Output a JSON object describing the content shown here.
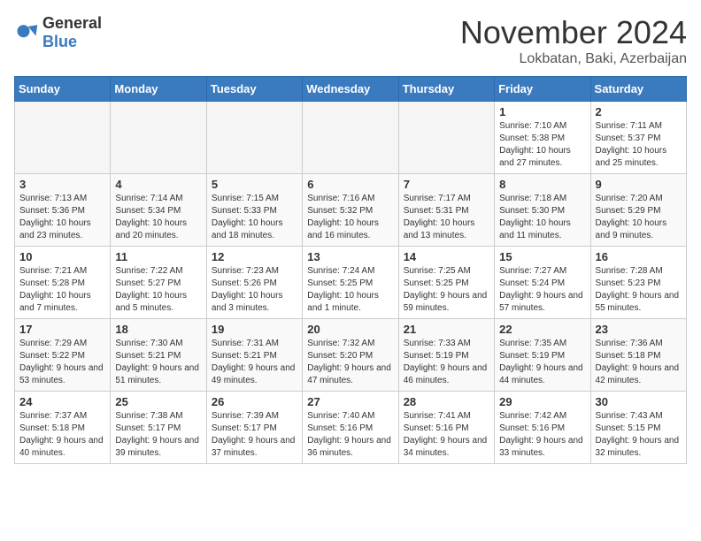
{
  "header": {
    "logo_general": "General",
    "logo_blue": "Blue",
    "month_title": "November 2024",
    "location": "Lokbatan, Baki, Azerbaijan"
  },
  "weekdays": [
    "Sunday",
    "Monday",
    "Tuesday",
    "Wednesday",
    "Thursday",
    "Friday",
    "Saturday"
  ],
  "weeks": [
    [
      {
        "day": "",
        "info": ""
      },
      {
        "day": "",
        "info": ""
      },
      {
        "day": "",
        "info": ""
      },
      {
        "day": "",
        "info": ""
      },
      {
        "day": "",
        "info": ""
      },
      {
        "day": "1",
        "info": "Sunrise: 7:10 AM\nSunset: 5:38 PM\nDaylight: 10 hours and 27 minutes."
      },
      {
        "day": "2",
        "info": "Sunrise: 7:11 AM\nSunset: 5:37 PM\nDaylight: 10 hours and 25 minutes."
      }
    ],
    [
      {
        "day": "3",
        "info": "Sunrise: 7:13 AM\nSunset: 5:36 PM\nDaylight: 10 hours and 23 minutes."
      },
      {
        "day": "4",
        "info": "Sunrise: 7:14 AM\nSunset: 5:34 PM\nDaylight: 10 hours and 20 minutes."
      },
      {
        "day": "5",
        "info": "Sunrise: 7:15 AM\nSunset: 5:33 PM\nDaylight: 10 hours and 18 minutes."
      },
      {
        "day": "6",
        "info": "Sunrise: 7:16 AM\nSunset: 5:32 PM\nDaylight: 10 hours and 16 minutes."
      },
      {
        "day": "7",
        "info": "Sunrise: 7:17 AM\nSunset: 5:31 PM\nDaylight: 10 hours and 13 minutes."
      },
      {
        "day": "8",
        "info": "Sunrise: 7:18 AM\nSunset: 5:30 PM\nDaylight: 10 hours and 11 minutes."
      },
      {
        "day": "9",
        "info": "Sunrise: 7:20 AM\nSunset: 5:29 PM\nDaylight: 10 hours and 9 minutes."
      }
    ],
    [
      {
        "day": "10",
        "info": "Sunrise: 7:21 AM\nSunset: 5:28 PM\nDaylight: 10 hours and 7 minutes."
      },
      {
        "day": "11",
        "info": "Sunrise: 7:22 AM\nSunset: 5:27 PM\nDaylight: 10 hours and 5 minutes."
      },
      {
        "day": "12",
        "info": "Sunrise: 7:23 AM\nSunset: 5:26 PM\nDaylight: 10 hours and 3 minutes."
      },
      {
        "day": "13",
        "info": "Sunrise: 7:24 AM\nSunset: 5:25 PM\nDaylight: 10 hours and 1 minute."
      },
      {
        "day": "14",
        "info": "Sunrise: 7:25 AM\nSunset: 5:25 PM\nDaylight: 9 hours and 59 minutes."
      },
      {
        "day": "15",
        "info": "Sunrise: 7:27 AM\nSunset: 5:24 PM\nDaylight: 9 hours and 57 minutes."
      },
      {
        "day": "16",
        "info": "Sunrise: 7:28 AM\nSunset: 5:23 PM\nDaylight: 9 hours and 55 minutes."
      }
    ],
    [
      {
        "day": "17",
        "info": "Sunrise: 7:29 AM\nSunset: 5:22 PM\nDaylight: 9 hours and 53 minutes."
      },
      {
        "day": "18",
        "info": "Sunrise: 7:30 AM\nSunset: 5:21 PM\nDaylight: 9 hours and 51 minutes."
      },
      {
        "day": "19",
        "info": "Sunrise: 7:31 AM\nSunset: 5:21 PM\nDaylight: 9 hours and 49 minutes."
      },
      {
        "day": "20",
        "info": "Sunrise: 7:32 AM\nSunset: 5:20 PM\nDaylight: 9 hours and 47 minutes."
      },
      {
        "day": "21",
        "info": "Sunrise: 7:33 AM\nSunset: 5:19 PM\nDaylight: 9 hours and 46 minutes."
      },
      {
        "day": "22",
        "info": "Sunrise: 7:35 AM\nSunset: 5:19 PM\nDaylight: 9 hours and 44 minutes."
      },
      {
        "day": "23",
        "info": "Sunrise: 7:36 AM\nSunset: 5:18 PM\nDaylight: 9 hours and 42 minutes."
      }
    ],
    [
      {
        "day": "24",
        "info": "Sunrise: 7:37 AM\nSunset: 5:18 PM\nDaylight: 9 hours and 40 minutes."
      },
      {
        "day": "25",
        "info": "Sunrise: 7:38 AM\nSunset: 5:17 PM\nDaylight: 9 hours and 39 minutes."
      },
      {
        "day": "26",
        "info": "Sunrise: 7:39 AM\nSunset: 5:17 PM\nDaylight: 9 hours and 37 minutes."
      },
      {
        "day": "27",
        "info": "Sunrise: 7:40 AM\nSunset: 5:16 PM\nDaylight: 9 hours and 36 minutes."
      },
      {
        "day": "28",
        "info": "Sunrise: 7:41 AM\nSunset: 5:16 PM\nDaylight: 9 hours and 34 minutes."
      },
      {
        "day": "29",
        "info": "Sunrise: 7:42 AM\nSunset: 5:16 PM\nDaylight: 9 hours and 33 minutes."
      },
      {
        "day": "30",
        "info": "Sunrise: 7:43 AM\nSunset: 5:15 PM\nDaylight: 9 hours and 32 minutes."
      }
    ]
  ]
}
